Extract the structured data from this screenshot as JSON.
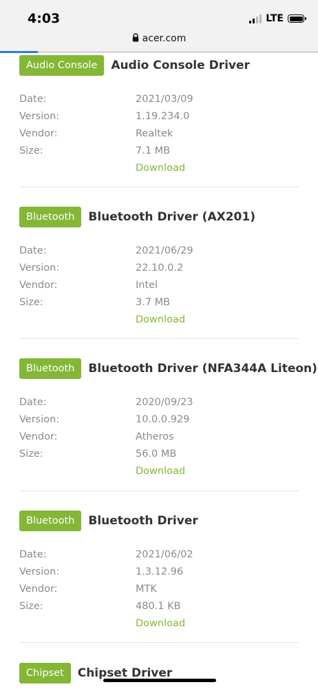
{
  "status": {
    "time": "4:03",
    "network": "LTE",
    "signal_bars": 4,
    "signal_active_bars": 2
  },
  "browser": {
    "url": "acer.com",
    "load_progress": 0.12
  },
  "labels": {
    "date": "Date:",
    "version": "Version:",
    "vendor": "Vendor:",
    "size": "Size:",
    "download": "Download"
  },
  "drivers": [
    {
      "category": "Audio Console",
      "title": "Audio Console Driver",
      "date": "2021/03/09",
      "version": "1.19.234.0",
      "vendor": "Realtek",
      "size": "7.1 MB"
    },
    {
      "category": "Bluetooth",
      "title": "Bluetooth Driver (AX201)",
      "date": "2021/06/29",
      "version": "22.10.0.2",
      "vendor": "Intel",
      "size": "3.7 MB"
    },
    {
      "category": "Bluetooth",
      "title": "Bluetooth Driver (NFA344A Liteon)",
      "date": "2020/09/23",
      "version": "10.0.0.929",
      "vendor": "Atheros",
      "size": "56.0 MB"
    },
    {
      "category": "Bluetooth",
      "title": "Bluetooth Driver",
      "date": "2021/06/02",
      "version": "1.3.12.96",
      "vendor": "MTK",
      "size": "480.1 KB"
    },
    {
      "category": "Chipset",
      "title": "Chipset Driver"
    }
  ],
  "colors": {
    "accent": "#83b735",
    "label_text": "#8a8a8a",
    "title_text": "#333333"
  }
}
